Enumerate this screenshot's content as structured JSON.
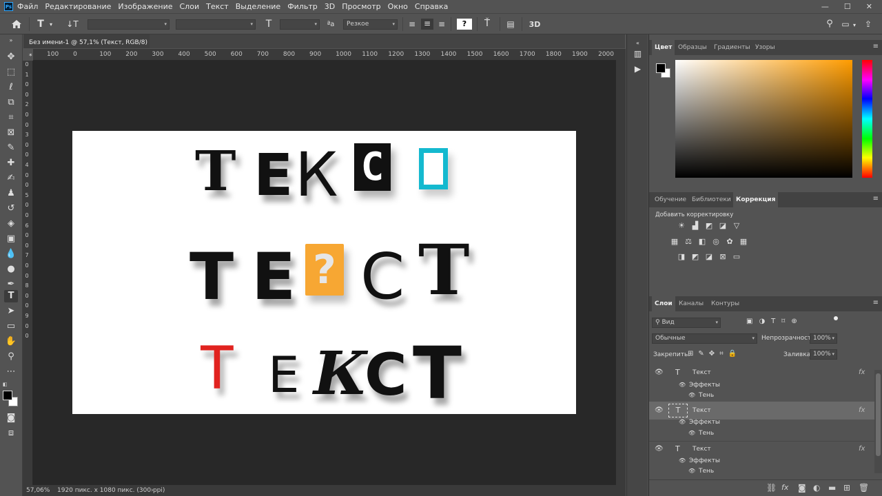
{
  "app": {
    "logo": "Ps",
    "menu": [
      "Файл",
      "Редактирование",
      "Изображение",
      "Слои",
      "Текст",
      "Выделение",
      "Фильтр",
      "3D",
      "Просмотр",
      "Окно",
      "Справка"
    ],
    "window_buttons": [
      "—",
      "☐",
      "✕"
    ]
  },
  "options_bar": {
    "home_icon": "home-icon",
    "tool_icon": "T",
    "orient_icon": "↓T",
    "font_family": "",
    "font_style": "",
    "size_icon": "T",
    "font_size": "",
    "aa_label": "ªa",
    "antialias": "Резкое",
    "color_swatch": "?",
    "threed_label": "3D"
  },
  "document": {
    "tab_title": "Без имени-1 @ 57,1% (Текст, RGB/8) *",
    "tab_close": "×",
    "status_zoom": "57,06%",
    "status_info": "1920 пикс. x 1080 пикс. (300 ppi)",
    "status_arrow": "›",
    "ruler_h": [
      "100",
      "0",
      "100",
      "200",
      "300",
      "400",
      "500",
      "600",
      "700",
      "800",
      "900",
      "1000",
      "1100",
      "1200",
      "1300",
      "1400",
      "1500",
      "1600",
      "1700",
      "1800",
      "1900",
      "2000"
    ],
    "ruler_v": [
      "0",
      "1",
      "0",
      "0",
      "2",
      "0",
      "0",
      "3",
      "0",
      "0",
      "4",
      "0",
      "0",
      "5",
      "0",
      "0",
      "6",
      "0",
      "0",
      "7",
      "0",
      "0",
      "8",
      "0",
      "0",
      "9",
      "0",
      "0"
    ]
  },
  "artwork": {
    "row1": [
      "Т",
      "Е",
      "К",
      "С",
      "□"
    ],
    "row2": [
      "Т",
      "Е",
      "?",
      "С",
      "Т"
    ],
    "row3": [
      "Т",
      "Е",
      "К",
      "С",
      "Т"
    ],
    "colors": {
      "orange": "#f7a733",
      "cyan": "#14b9cf",
      "red": "#e1231f",
      "black": "#111111"
    }
  },
  "panels": {
    "color_tabs": [
      "Цвет",
      "Образцы",
      "Градиенты",
      "Узоры"
    ],
    "learn_tabs": [
      "Обучение",
      "Библиотеки",
      "Коррекция"
    ],
    "add_adjustment": "Добавить корректировку",
    "layers_tabs": [
      "Слои",
      "Каналы",
      "Контуры"
    ],
    "filter_kind": "Вид",
    "blend_mode": "Обычные",
    "opacity_label": "Непрозрачность:",
    "opacity_value": "100%",
    "lock_label": "Закрепить:",
    "fill_label": "Заливка:",
    "fill_value": "100%",
    "layers": [
      {
        "name": "Текст",
        "effects": "Эффекты",
        "effect": "Тень",
        "fx": "fx"
      },
      {
        "name": "Текст",
        "effects": "Эффекты",
        "effect": "Тень",
        "fx": "fx"
      },
      {
        "name": "Текст",
        "effects": "Эффекты",
        "effect": "Тень",
        "fx": "fx"
      }
    ],
    "footer_icons": [
      "link-icon",
      "fx-icon",
      "mask-icon",
      "adjustment-icon",
      "group-icon",
      "new-layer-icon",
      "trash-icon"
    ]
  }
}
